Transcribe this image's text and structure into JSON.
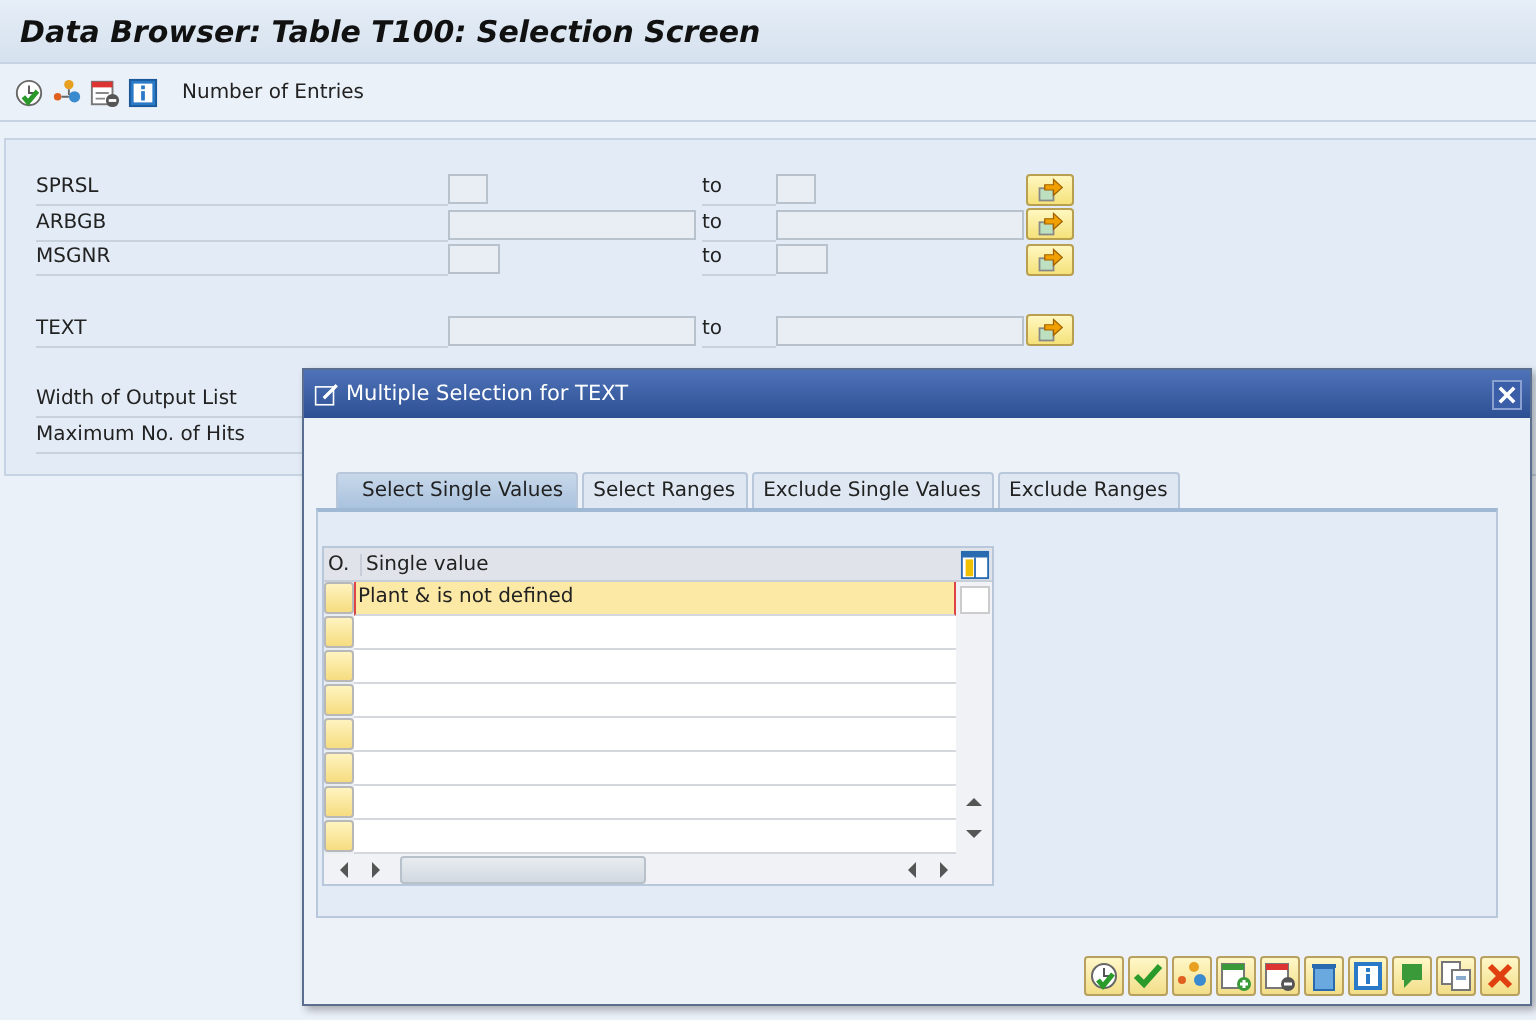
{
  "window": {
    "title": "Data Browser: Table T100: Selection Screen"
  },
  "toolbar": {
    "label": "Number of Entries"
  },
  "fields": [
    {
      "label": "SPRSL",
      "to": "to"
    },
    {
      "label": "ARBGB",
      "to": "to"
    },
    {
      "label": "MSGNR",
      "to": "to"
    },
    {
      "label": "TEXT",
      "to": "to"
    }
  ],
  "settings": [
    {
      "label": "Width of Output List"
    },
    {
      "label": "Maximum No. of Hits"
    }
  ],
  "dialog": {
    "title": "Multiple Selection for TEXT",
    "tabs": [
      {
        "label": "Select Single Values",
        "selected": true
      },
      {
        "label": "Select Ranges",
        "selected": false
      },
      {
        "label": "Exclude Single Values",
        "selected": false
      },
      {
        "label": "Exclude Ranges",
        "selected": false
      }
    ],
    "table": {
      "columns": [
        "O.",
        "Single value"
      ],
      "rows": [
        {
          "value": "Plant & is not defined",
          "current": true
        },
        {
          "current": false
        },
        {
          "current": false
        },
        {
          "current": false
        },
        {
          "current": false
        },
        {
          "current": false
        },
        {
          "current": false
        },
        {
          "current": false
        }
      ]
    }
  }
}
